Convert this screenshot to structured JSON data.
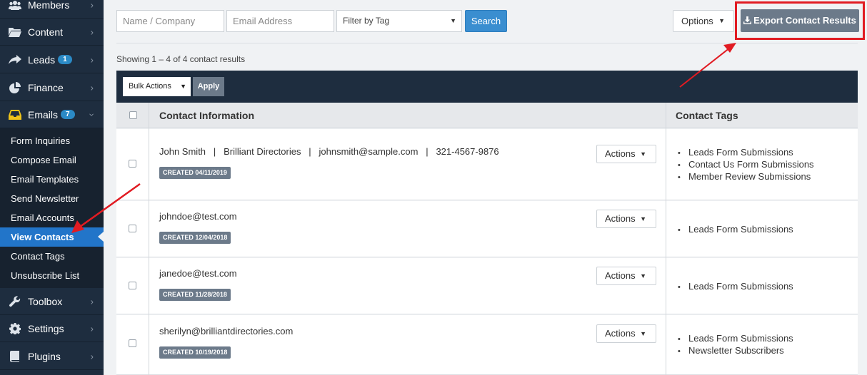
{
  "sidebar": {
    "items": [
      {
        "label": "Members",
        "icon": "users-icon"
      },
      {
        "label": "Content",
        "icon": "folder-icon"
      },
      {
        "label": "Leads",
        "icon": "share-icon",
        "badge": "1"
      },
      {
        "label": "Finance",
        "icon": "pie-chart-icon"
      },
      {
        "label": "Emails",
        "icon": "inbox-icon",
        "badge": "7"
      },
      {
        "label": "Toolbox",
        "icon": "wrench-icon"
      },
      {
        "label": "Settings",
        "icon": "gear-icon"
      },
      {
        "label": "Plugins",
        "icon": "book-icon"
      }
    ],
    "email_submenu": [
      "Form Inquiries",
      "Compose Email",
      "Email Templates",
      "Send Newsletter",
      "Email Accounts",
      "View Contacts",
      "Contact Tags",
      "Unsubscribe List"
    ],
    "active": "View Contacts"
  },
  "toolbar": {
    "name_placeholder": "Name / Company",
    "email_placeholder": "Email Address",
    "tag_filter": "Filter by Tag",
    "search_label": "Search",
    "options_label": "Options",
    "export_label": "Export Contact Results"
  },
  "results_text": "Showing 1 – 4 of 4 contact results",
  "bulk": {
    "select_label": "Bulk Actions",
    "apply_label": "Apply"
  },
  "table": {
    "headers": [
      "Contact Information",
      "Contact Tags"
    ],
    "actions_label": "Actions",
    "rows": [
      {
        "contact": "John Smith   |   Brilliant Directories   |   johnsmith@sample.com   |   321-4567-9876",
        "created": "CREATED 04/11/2019",
        "tags": [
          "Leads Form Submissions",
          "Contact Us Form Submissions",
          "Member Review Submissions"
        ]
      },
      {
        "contact": "johndoe@test.com",
        "created": "CREATED 12/04/2018",
        "tags": [
          "Leads Form Submissions"
        ]
      },
      {
        "contact": "janedoe@test.com",
        "created": "CREATED 11/28/2018",
        "tags": [
          "Leads Form Submissions"
        ]
      },
      {
        "contact": "sherilyn@brilliantdirectories.com",
        "created": "CREATED 10/19/2018",
        "tags": [
          "Leads Form Submissions",
          "Newsletter Subscribers"
        ]
      }
    ]
  },
  "colors": {
    "sidebar_bg": "#1e2d3f",
    "active_item": "#2275c9",
    "badge": "#2b8ac6",
    "primary_button": "#3a8ed0",
    "highlight": "#e11b22"
  }
}
